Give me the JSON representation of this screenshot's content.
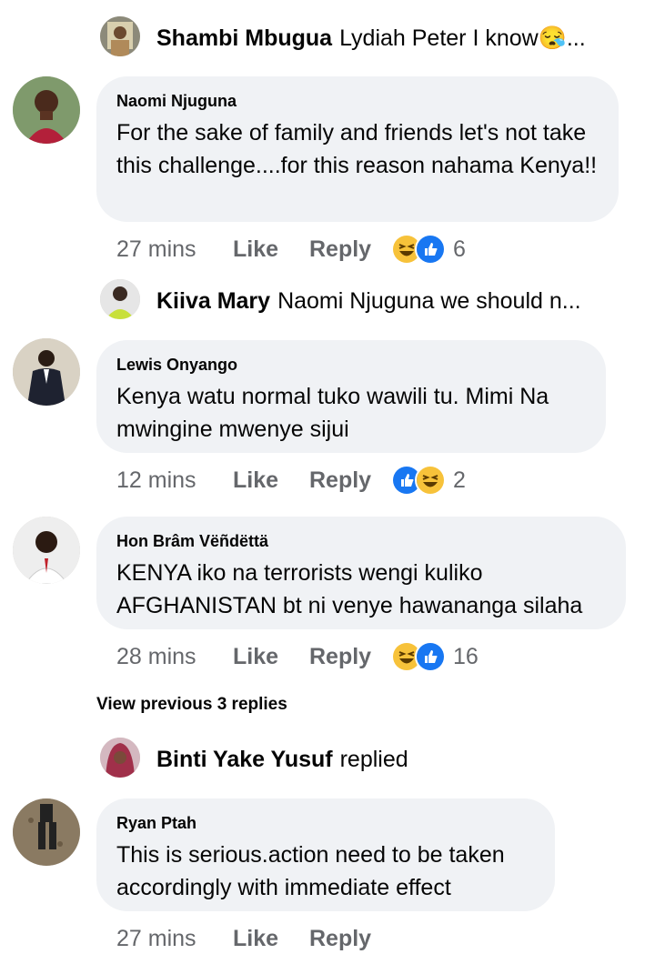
{
  "replies_preview": [
    {
      "name": "Shambi Mbugua",
      "text": "Lydiah Peter I know😪..."
    },
    {
      "name": "Kiiva Mary",
      "text": "Naomi Njuguna we should  n..."
    },
    {
      "name": "Binti Yake Yusuf",
      "text": "replied"
    }
  ],
  "comments": [
    {
      "name": "Naomi Njuguna",
      "text": "For the sake of family and friends let's not take this challenge....for this reason nahama Kenya!!",
      "time": "27 mins",
      "like": "Like",
      "reply": "Reply",
      "reactions": [
        "haha",
        "like"
      ],
      "count": "6"
    },
    {
      "name": "Lewis Onyango",
      "text": "Kenya watu normal tuko wawili tu. Mimi Na mwingine mwenye sijui",
      "time": "12 mins",
      "like": "Like",
      "reply": "Reply",
      "reactions": [
        "like",
        "haha"
      ],
      "count": "2"
    },
    {
      "name": "Hon Brâm Vëñdëttä",
      "text": "KENYA iko na terrorists wengi kuliko AFGHANISTAN bt ni venye hawananga silaha",
      "time": "28 mins",
      "like": "Like",
      "reply": "Reply",
      "reactions": [
        "haha",
        "like"
      ],
      "count": "16"
    },
    {
      "name": "Ryan Ptah",
      "text": "This is serious.action need to be taken accordingly with immediate effect",
      "time": "27 mins",
      "like": "Like",
      "reply": "Reply",
      "reactions": [],
      "count": ""
    }
  ],
  "view_previous": "View previous 3 replies",
  "colors": {
    "bubble": "#f0f2f5",
    "meta": "#65676b",
    "like_blue": "#1877f2",
    "haha_yellow": "#f7c23a"
  }
}
